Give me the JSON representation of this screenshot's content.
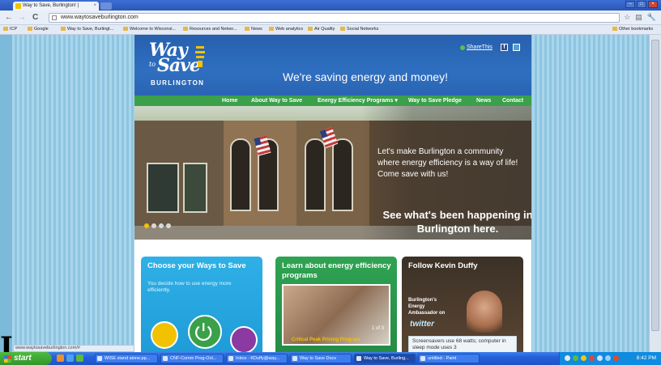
{
  "browser": {
    "tab_title": "Way to Save, Burlington! |",
    "tab_close": "×",
    "url": "www.waytosaveburlington.com",
    "nav": {
      "back": "←",
      "forward": "→",
      "reload": "C"
    },
    "bookmarks": [
      "ICP",
      "Google",
      "Way to Save, Burlingt...",
      "Welcome to Wisconsi...",
      "Resources and Netwo...",
      "News",
      "Web analytics",
      "Air Quality",
      "Social Networks"
    ],
    "other_bookmarks": "Other bookmarks",
    "status_url": "www.waytosaveburlington.com/#"
  },
  "site": {
    "logo": {
      "line1": "Way",
      "line2_small": "to",
      "line2": "Save",
      "city": "BURLINGTON"
    },
    "tagline": "We're saving energy and money!",
    "share": "ShareThis",
    "nav": [
      "Home",
      "About Way to Save",
      "Energy Efficiency Programs ▾",
      "Way to Save Pledge",
      "News",
      "Contact"
    ],
    "hero": {
      "message": "Let's make Burlington a community where energy efficiency is a way of life! Come save with us!",
      "cta": "See what's been happening in Burlington here."
    },
    "cards": {
      "ways": {
        "title": "Choose your Ways to Save",
        "text": "You decide how to use energy more efficiently."
      },
      "learn": {
        "title": "Learn about energy efficiency programs",
        "pager": "1 of 3",
        "caption": "Critical Peak Pricing Program"
      },
      "follow": {
        "title": "Follow Kevin Duffy",
        "intro": "Burlington's Energy Ambassador on",
        "twitter": "twitter",
        "tweet": "Screensavers use 68 watts; computer in sleep mode uses 3"
      }
    }
  },
  "taskbar": {
    "start": "start",
    "buttons": [
      "WISE stand alone.pp...",
      "CNF-Comm Prog-Oct...",
      "Inbox - KDuffy@way...",
      "Way to Save Docs",
      "Way to Save, Burling...",
      "untitled - Paint"
    ],
    "clock": "8:42 PM"
  },
  "colors": {
    "site_blue": "#2a64b3",
    "nav_green": "#3aa04a",
    "card_blue": "#1f9cd8",
    "card_green": "#258c45",
    "accent_yellow": "#f2c200"
  }
}
